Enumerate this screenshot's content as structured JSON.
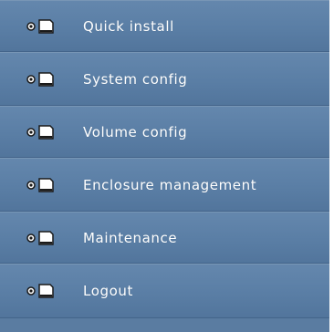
{
  "colors": {
    "menu_background": "#5a7ca1",
    "label_text": "#ffffff",
    "icon_fill": "#ffffff",
    "icon_outline": "#1a1a1a"
  },
  "menu": {
    "items": [
      {
        "label": "Quick install",
        "icon": "document-icon"
      },
      {
        "label": "System config",
        "icon": "document-icon"
      },
      {
        "label": "Volume config",
        "icon": "document-icon"
      },
      {
        "label": "Enclosure management",
        "icon": "document-icon"
      },
      {
        "label": "Maintenance",
        "icon": "document-icon"
      },
      {
        "label": "Logout",
        "icon": "document-icon"
      }
    ]
  }
}
